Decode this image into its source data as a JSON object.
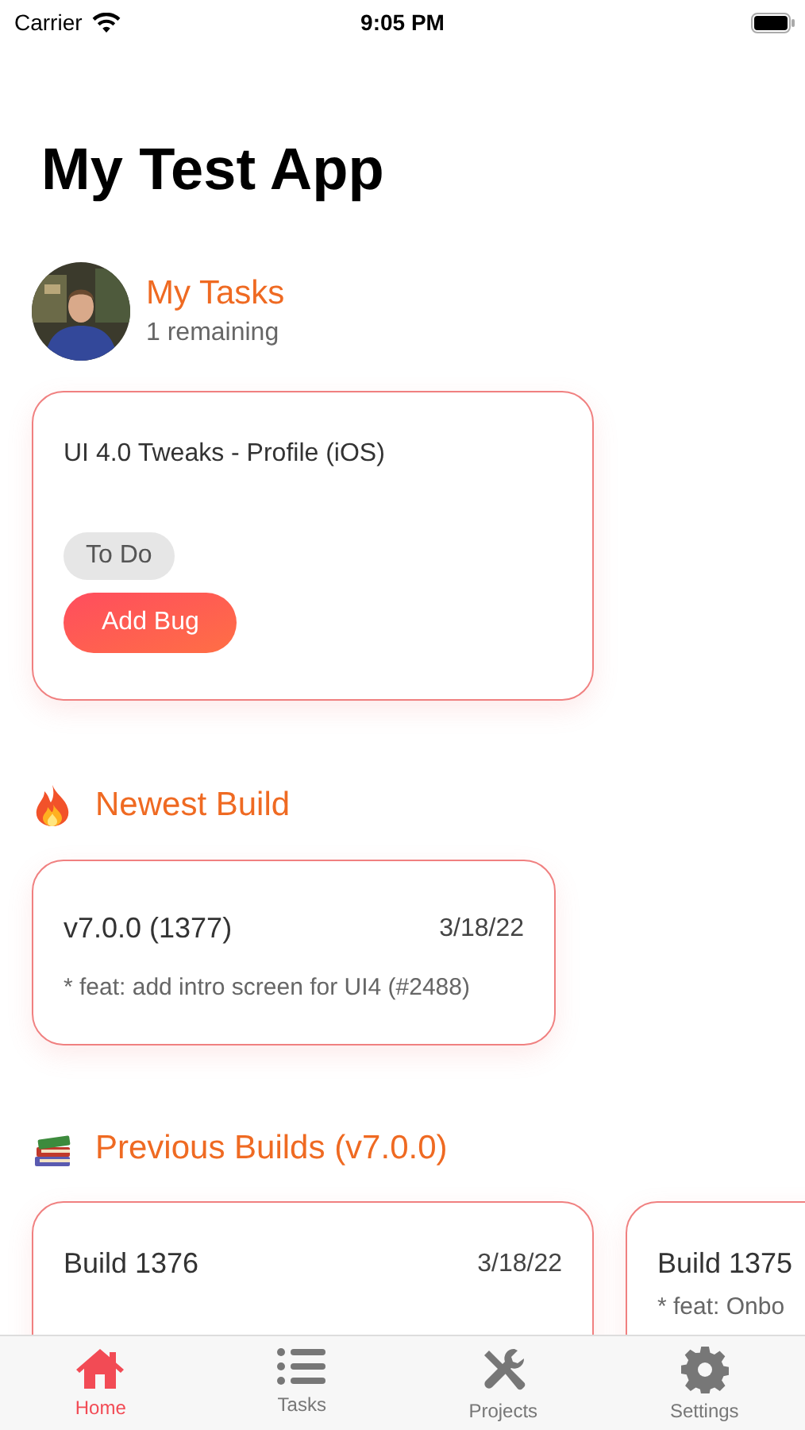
{
  "status_bar": {
    "carrier": "Carrier",
    "time": "9:05 PM"
  },
  "title": "My Test App",
  "my_tasks": {
    "title": "My Tasks",
    "subtitle": "1 remaining",
    "tasks": [
      {
        "name": "UI 4.0 Tweaks - Profile (iOS)",
        "status": "To Do",
        "action": "Add Bug"
      }
    ]
  },
  "newest_build": {
    "title": "Newest Build",
    "build": {
      "name": "v7.0.0 (1377)",
      "date": "3/18/22",
      "note": "* feat: add intro screen for UI4 (#2488)"
    }
  },
  "previous_builds": {
    "title": "Previous Builds (v7.0.0)",
    "builds": [
      {
        "name": "Build 1376",
        "date": "3/18/22"
      },
      {
        "name": "Build 1375",
        "note": "* feat: Onbo"
      }
    ]
  },
  "tab_bar": [
    {
      "label": "Home",
      "selected": true
    },
    {
      "label": "Tasks",
      "selected": false
    },
    {
      "label": "Projects",
      "selected": false
    },
    {
      "label": "Settings",
      "selected": false
    }
  ]
}
